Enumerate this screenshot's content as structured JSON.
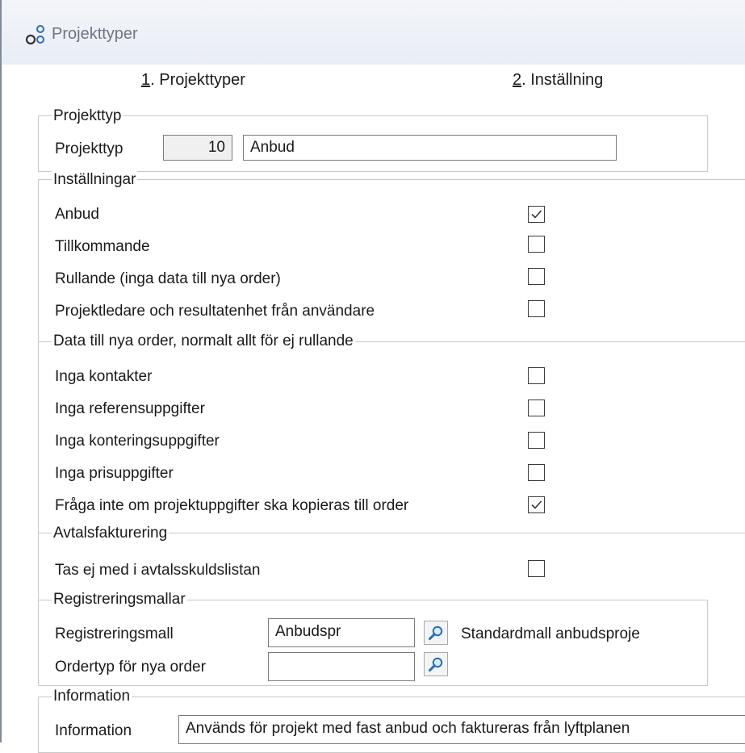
{
  "window": {
    "title": "Projekttyper",
    "icon": "app-shapes-icon"
  },
  "tabs": [
    {
      "mnemonic": "1",
      "label": ". Projekttyper"
    },
    {
      "mnemonic": "2",
      "label": ". Inställning"
    }
  ],
  "group_projekttyp": {
    "title": "Projekttyp",
    "label": "Projekttyp",
    "number": "10",
    "name": "Anbud"
  },
  "group_installningar": {
    "title": "Inställningar",
    "items": [
      {
        "label": "Anbud",
        "checked": true
      },
      {
        "label": "Tillkommande",
        "checked": false
      },
      {
        "label": "Rullande (inga data till nya order)",
        "checked": false
      },
      {
        "label": "Projektledare och resultatenhet från användare",
        "checked": false
      }
    ]
  },
  "group_data": {
    "title": "Data till nya order, normalt allt för ej rullande",
    "items": [
      {
        "label": "Inga kontakter",
        "checked": false
      },
      {
        "label": "Inga referensuppgifter",
        "checked": false
      },
      {
        "label": "Inga konteringsuppgifter",
        "checked": false
      },
      {
        "label": "Inga prisuppgifter",
        "checked": false
      },
      {
        "label": "Fråga inte om projektuppgifter ska kopieras till order",
        "checked": true
      }
    ]
  },
  "group_avtal": {
    "title": "Avtalsfakturering",
    "items": [
      {
        "label": "Tas ej med i avtalsskuldslistan",
        "checked": false
      }
    ]
  },
  "group_reg": {
    "title": "Registreringsmallar",
    "registreringsmall_label": "Registreringsmall",
    "registreringsmall_value": "Anbudspr",
    "registreringsmall_desc": "Standardmall anbudsproje",
    "ordertyp_label": "Ordertyp för nya order",
    "ordertyp_value": ""
  },
  "group_info": {
    "title": "Information",
    "label": "Information",
    "value": "Används för projekt med fast anbud och faktureras från lyftplanen"
  },
  "colors": {
    "accent": "#1f6fc1",
    "frame": "#7f8a9a",
    "group_border": "#c9c9c9"
  }
}
